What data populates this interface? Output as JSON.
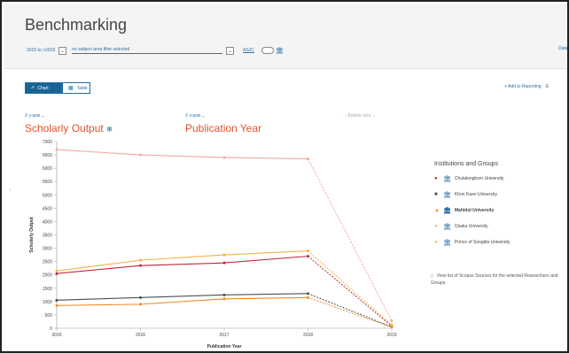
{
  "header": {
    "title": "Benchmarking",
    "year_range": "2015 to >2018",
    "subject_filter": "no subject area filter selected",
    "asjc": "ASJC",
    "data_link": "Data"
  },
  "toolbar": {
    "chart_tab": "Chart",
    "table_tab": "Table",
    "add_to_reporting": "+ Add to Reporting",
    "export_short": "E"
  },
  "axes": {
    "y_selector": "y-axis",
    "x_selector": "x-axis",
    "bubble_size": "Bubble size",
    "y_metric": "Scholarly Output",
    "x_metric": "Publication Year"
  },
  "legend": {
    "title": "Institutions and Groups",
    "items": [
      {
        "name": "Chulalongkorn University",
        "color": "#c0283a",
        "marker": "●"
      },
      {
        "name": "Khon Kaen University",
        "color": "#4a4f58",
        "marker": "■"
      },
      {
        "name": "Mahidol University",
        "color": "#f08a24",
        "marker": "▲"
      },
      {
        "name": "Osaka University",
        "color": "#f4a7a0",
        "marker": "●"
      },
      {
        "name": "Prince of Songkla University",
        "color": "#f3b24a",
        "marker": "●"
      }
    ],
    "view_list": "View list of Scopus Sources for the selected Researchers and Groups"
  },
  "chart_data": {
    "type": "line",
    "xlabel": "Publication Year",
    "ylabel": "Scholarly Output",
    "x": [
      "2015",
      "2016",
      "2017",
      "2018",
      "2019"
    ],
    "ylim": [
      0,
      7000
    ],
    "yticks": [
      0,
      500,
      1000,
      1500,
      2000,
      2500,
      3000,
      3500,
      4000,
      4500,
      5000,
      5500,
      6000,
      6500,
      7000
    ],
    "series": [
      {
        "name": "Chulalongkorn University",
        "color": "#c0283a",
        "values": [
          2050,
          2350,
          2450,
          2700,
          80
        ]
      },
      {
        "name": "Khon Kaen University",
        "color": "#4a4f58",
        "values": [
          1050,
          1150,
          1250,
          1300,
          50
        ]
      },
      {
        "name": "Mahidol University",
        "color": "#f08a24",
        "values": [
          850,
          900,
          1100,
          1150,
          40
        ]
      },
      {
        "name": "Osaka University",
        "color": "#f4a7a0",
        "values": [
          6700,
          6500,
          6400,
          6350,
          280
        ]
      },
      {
        "name": "Prince of Songkla University",
        "color": "#f3b24a",
        "values": [
          2150,
          2550,
          2750,
          2900,
          120
        ]
      }
    ]
  }
}
